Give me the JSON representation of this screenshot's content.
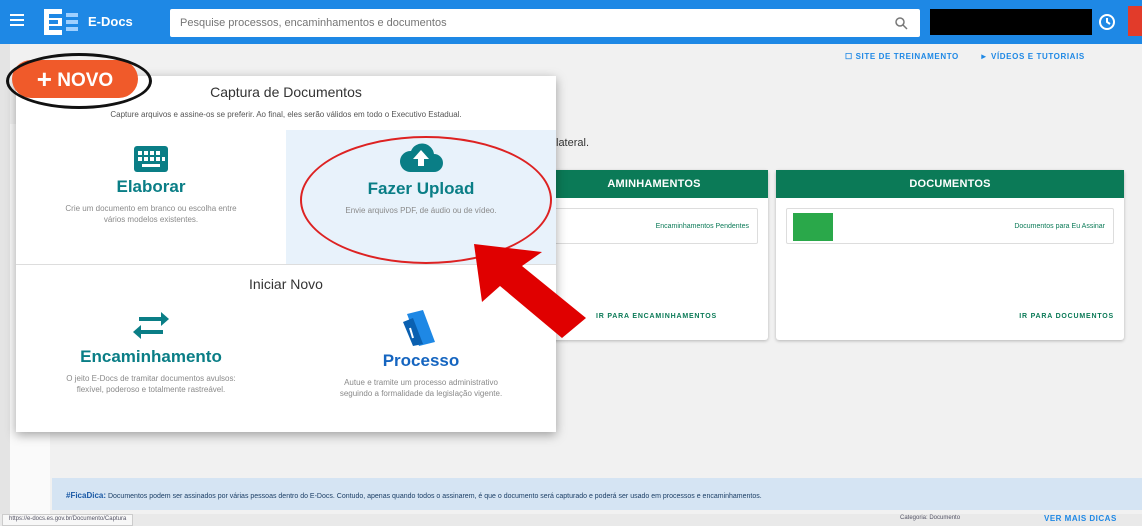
{
  "topbar": {
    "brand": "E-Docs",
    "search_placeholder": "Pesquise processos, encaminhamentos e documentos"
  },
  "toplinks": {
    "training": "SITE DE TREINAMENTO",
    "videos": "VÍDEOS E TUTORIAIS"
  },
  "background": {
    "partial_text": "lateral.",
    "cards": {
      "encaminhamentos": {
        "header": "AMINHAMENTOS",
        "row": "Encaminhamentos Pendentes",
        "footer": "IR PARA ENCAMINHAMENTOS"
      },
      "documentos": {
        "header": "DOCUMENTOS",
        "row": "Documentos para Eu Assinar",
        "footer": "IR PARA DOCUMENTOS"
      }
    }
  },
  "novo_button": {
    "label": "NOVO",
    "icon": "plus-icon"
  },
  "popup": {
    "title": "Captura de Documentos",
    "subtitle": "Capture arquivos e assine-os se preferir. Ao final, eles serão válidos em todo o Executivo Estadual.",
    "options_capture": [
      {
        "title": "Elaborar",
        "desc1": "Crie um documento em branco ou escolha entre",
        "desc2": "vários modelos existentes.",
        "icon": "keyboard-icon"
      },
      {
        "title": "Fazer Upload",
        "desc1": "Envie arquivos PDF, de áudio ou de vídeo.",
        "desc2": "",
        "icon": "cloud-upload-icon"
      }
    ],
    "section2_title": "Iniciar Novo",
    "options_new": [
      {
        "title": "Encaminhamento",
        "desc1": "O jeito E-Docs de tramitar documentos avulsos:",
        "desc2": "flexível, poderoso e totalmente rastreável.",
        "icon": "swap-arrows-icon"
      },
      {
        "title": "Processo",
        "desc1": "Autue e tramite um processo administrativo",
        "desc2": "seguindo a formalidade da legislação vigente.",
        "icon": "folder-icon"
      }
    ]
  },
  "banner": {
    "tag": "#FicaDica:",
    "text": "Documentos podem ser assinados por várias pessoas dentro do E-Docs. Contudo, apenas quando todos o assinarem, é que o documento será capturado e poderá ser usado em processos e encaminhamentos."
  },
  "status": {
    "url": "https://e-docs.es.gov.br/Documento/Captura",
    "category": "Categoria: Documento",
    "see_more": "VER MAIS DICAS"
  },
  "colors": {
    "topbar": "#1e88e5",
    "accent_teal": "#0a7e86",
    "card_header": "#0b7a57",
    "novo": "#f05a2a",
    "annotation_red": "#e00000"
  }
}
